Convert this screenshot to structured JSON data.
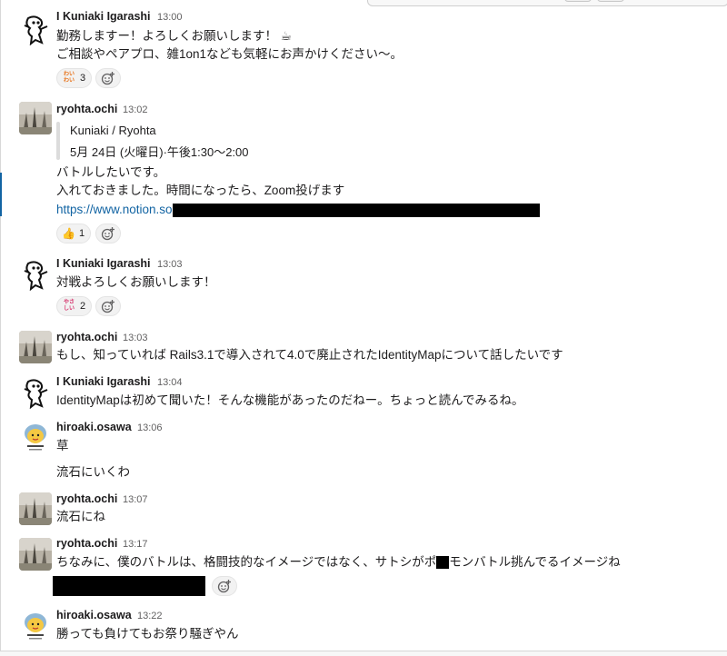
{
  "messages": [
    {
      "user": "I Kuniaki Igarashi",
      "time": "13:00",
      "lines": [
        "勤務しますー！よろしくお願いします！ ☕",
        "ご相談やペアプロ、雑1on1なども気軽にお声かけください〜。"
      ],
      "reaction": {
        "emoji_name": "wai-wai-stamp",
        "emoji_text": [
          "わい",
          "わい"
        ],
        "count": "3"
      }
    },
    {
      "user": "ryohta.ochi",
      "time": "13:02",
      "quote": [
        "Kuniaki / Ryohta",
        "5月 24日 (火曜日)·午後1:30〜2:00"
      ],
      "lines": [
        "バトルしたいです。",
        "入れておきました。時間になったら、Zoom投げます"
      ],
      "link": "https://www.notion.so",
      "reaction": {
        "emoji_name": "thumbs-up",
        "emoji_text": "👍",
        "count": "1"
      }
    },
    {
      "user": "I Kuniaki Igarashi",
      "time": "13:03",
      "lines": [
        "対戦よろしくお願いします！"
      ],
      "reaction": {
        "emoji_name": "yasashii-stamp",
        "emoji_text": [
          "やさ",
          "しい"
        ],
        "count": "2"
      }
    },
    {
      "user": "ryohta.ochi",
      "time": "13:03",
      "lines": [
        "もし、知っていれば Rails3.1で導入されて4.0で廃止されたIdentityMapについて話したいです"
      ]
    },
    {
      "user": "I Kuniaki Igarashi",
      "time": "13:04",
      "lines": [
        "IdentityMapは初めて聞いた！そんな機能があったのだねー。ちょっと読んでみるね。"
      ]
    },
    {
      "user": "hiroaki.osawa",
      "time": "13:06",
      "lines": [
        "草",
        "流石にいくわ"
      ]
    },
    {
      "user": "ryohta.ochi",
      "time": "13:07",
      "lines": [
        "流石にね"
      ]
    },
    {
      "user": "ryohta.ochi",
      "time": "13:17",
      "lines": [
        "ちなみに、僕のバトルは、格闘技的なイメージではなく、サトシがポ",
        "モンバトル挑んでるイメージね"
      ]
    },
    {
      "user": "hiroaki.osawa",
      "time": "13:22",
      "lines": [
        "勝っても負けてもお祭り騒ぎやん"
      ]
    }
  ],
  "colors": {
    "link": "#1264a3",
    "text": "#1d1c1d",
    "muted": "#616061",
    "reaction_bg": "#f2f2f2"
  }
}
